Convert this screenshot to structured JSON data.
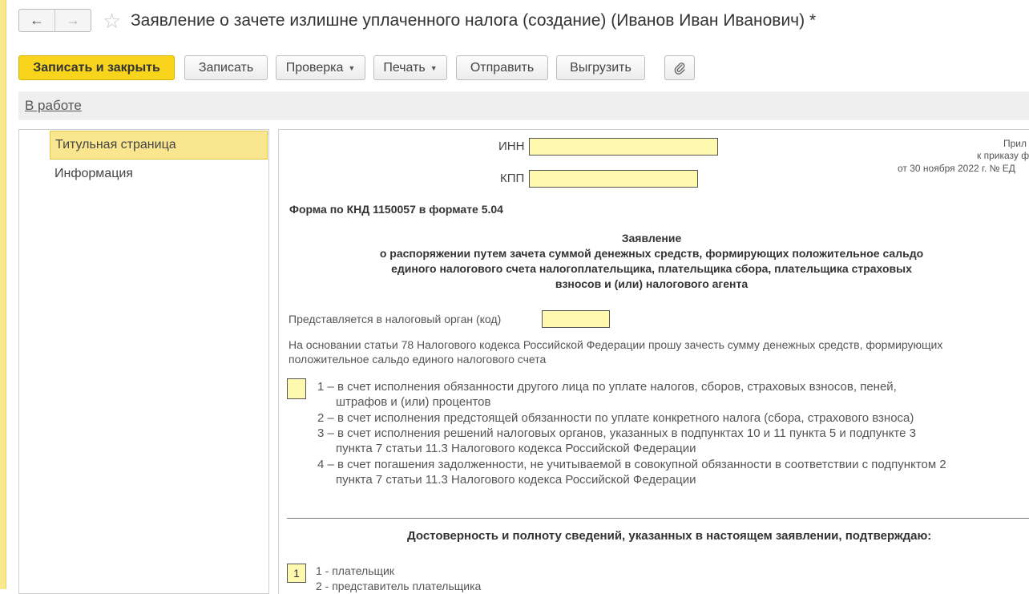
{
  "window": {
    "title": "Заявление о зачете излишне уплаченного налога (создание) (Иванов Иван Иванович) *"
  },
  "nav": {
    "back_icon": "←",
    "forward_icon": "→"
  },
  "toolbar": {
    "save_close": "Записать и закрыть",
    "save": "Записать",
    "check": "Проверка",
    "print": "Печать",
    "send": "Отправить",
    "export": "Выгрузить",
    "attach_icon": "paperclip-icon"
  },
  "status": {
    "link": "В работе"
  },
  "sidebar": {
    "items": [
      {
        "label": "Титульная страница",
        "active": true
      },
      {
        "label": "Информация",
        "active": false
      }
    ]
  },
  "form": {
    "inn_label": "ИНН",
    "kpp_label": "КПП",
    "appendix": [
      "Прил",
      "к приказу ф",
      "от 30 ноября 2022 г. № ЕД"
    ],
    "form_code": "Форма по КНД 1150057 в формате 5.04",
    "heading": "Заявление",
    "subheading": [
      "о распоряжении путем зачета суммой денежных средств, формирующих положительное сальдо",
      "единого налогового счета налогоплательщика, плательщика сбора, плательщика страховых",
      "взносов и (или) налогового агента"
    ],
    "authority_label": "Представляется в налоговый орган (код)",
    "basis_text": [
      "На основании статьи 78 Налогового кодекса Российской Федерации прошу зачесть сумму денежных средств, формирующих",
      "положительное сальдо единого налогового счета"
    ],
    "options": [
      "1 – в счет исполнения обязанности другого лица по уплате налогов, сборов, страховых взносов, пеней,",
      "штрафов и (или) процентов",
      "2 – в счет исполнения предстоящей обязанности по уплате конкретного налога (сбора, страхового взноса)",
      "3 – в счет исполнения решений налоговых органов, указанных в подпунктах 10 и 11 пункта 5 и подпункте 3",
      "пункта 7 статьи 11.3 Налогового кодекса Российской Федерации",
      "4 – в счет погашения задолженности, не учитываемой в совокупной обязанности в соответствии с подпунктом 2",
      "пункта 7 статьи 11.3 Налогового кодекса Российской Федерации"
    ],
    "confirm_heading": "Достоверность и полноту сведений, указанных в настоящем заявлении, подтверждаю:",
    "signer_value": "1",
    "signer_options": [
      "1 - плательщик",
      "2 - представитель плательщика"
    ]
  },
  "colors": {
    "accent": "#f8d41d",
    "field": "#fff9b0",
    "active_item": "#f9e68f"
  }
}
